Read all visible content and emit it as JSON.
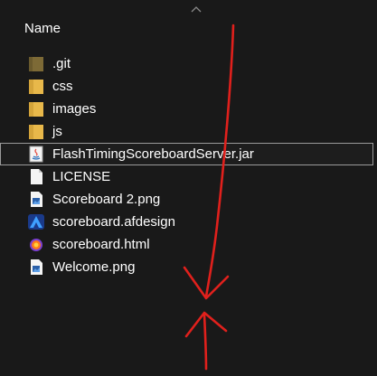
{
  "header": {
    "column_name": "Name"
  },
  "files": [
    {
      "name": ".git",
      "icon": "folder-dark-icon"
    },
    {
      "name": "css",
      "icon": "folder-icon"
    },
    {
      "name": "images",
      "icon": "folder-icon"
    },
    {
      "name": "js",
      "icon": "folder-icon"
    },
    {
      "name": "FlashTimingScoreboardServer.jar",
      "icon": "java-jar-icon",
      "selected": true
    },
    {
      "name": "LICENSE",
      "icon": "blank-file-icon"
    },
    {
      "name": "Scoreboard 2.png",
      "icon": "image-file-icon"
    },
    {
      "name": "scoreboard.afdesign",
      "icon": "affinity-designer-icon"
    },
    {
      "name": "scoreboard.html",
      "icon": "firefox-html-icon"
    },
    {
      "name": "Welcome.png",
      "icon": "image-file-icon"
    }
  ],
  "colors": {
    "background": "#191919",
    "folder": "#e8b84a",
    "folder_dark": "#7d6a36",
    "annotation": "#e0201c"
  }
}
